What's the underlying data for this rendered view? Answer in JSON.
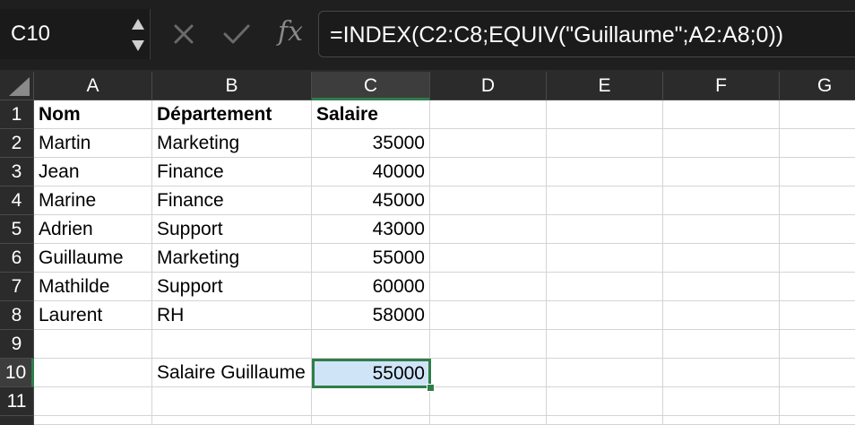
{
  "name_box": {
    "value": "C10"
  },
  "formula_bar": {
    "cancel_icon": "x-mark-icon",
    "confirm_icon": "check-mark-icon",
    "fx_label": "fx",
    "formula": "=INDEX(C2:C8;EQUIV(\"Guillaume\";A2:A8;0))"
  },
  "columns": [
    "A",
    "B",
    "C",
    "D",
    "E",
    "F",
    "G"
  ],
  "rows": [
    "1",
    "2",
    "3",
    "4",
    "5",
    "6",
    "7",
    "8",
    "9",
    "10",
    "11"
  ],
  "cells": {
    "A1": "Nom",
    "B1": "Département",
    "C1": "Salaire",
    "A2": "Martin",
    "B2": "Marketing",
    "C2": "35000",
    "A3": "Jean",
    "B3": "Finance",
    "C3": "40000",
    "A4": "Marine",
    "B4": "Finance",
    "C4": "45000",
    "A5": "Adrien",
    "B5": "Support",
    "C5": "43000",
    "A6": "Guillaume",
    "B6": "Marketing",
    "C6": "55000",
    "A7": "Mathilde",
    "B7": "Support",
    "C7": "60000",
    "A8": "Laurent",
    "B8": "RH",
    "C8": "58000",
    "B10": "Salaire Guillaume",
    "C10": "55000"
  },
  "selection": {
    "cell": "C10",
    "column": "C",
    "row": "10"
  },
  "colors": {
    "selection_border": "#2f7d4a",
    "selection_fill": "#cfe5f7",
    "header_bg": "#2b2b2b"
  }
}
